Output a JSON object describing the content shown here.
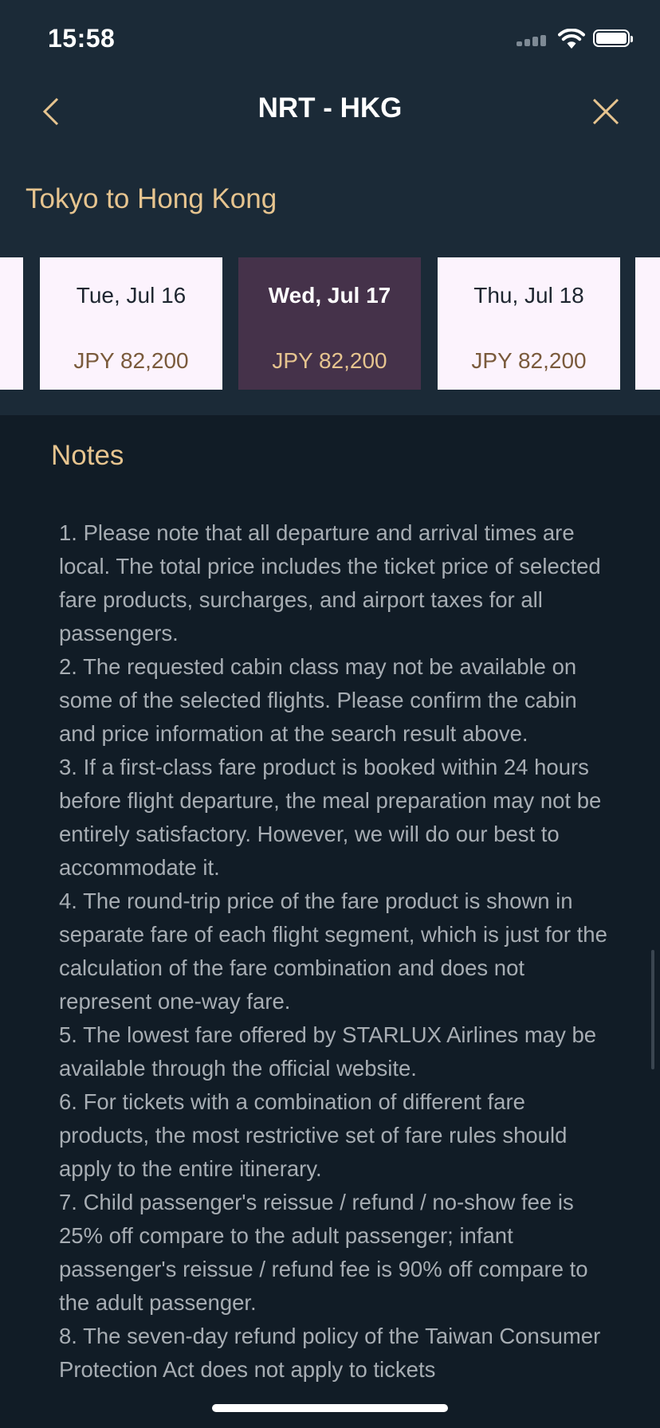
{
  "status_bar": {
    "time": "15:58"
  },
  "nav": {
    "title": "NRT - HKG",
    "back_icon": "chevron-left-icon",
    "close_icon": "close-icon",
    "accent_color": "#e6c48f"
  },
  "route": {
    "subtitle": "Tokyo to Hong Kong"
  },
  "dates": [
    {
      "date": "",
      "price": ""
    },
    {
      "date": "Tue, Jul 16",
      "price": "JPY 82,200"
    },
    {
      "date": "Wed, Jul 17",
      "price": "JPY 82,200",
      "selected": true
    },
    {
      "date": "Thu, Jul 18",
      "price": "JPY 82,200"
    },
    {
      "date": "",
      "price": ""
    }
  ],
  "notes": {
    "title": "Notes",
    "items": [
      "1. Please note that all departure and arrival times are local. The total price includes the ticket price of selected fare products, surcharges, and airport taxes for all passengers.",
      "2. The requested cabin class may not be available on some of the selected flights. Please confirm the cabin and price information at the search result above.",
      "3. If a first-class fare product is booked within 24 hours before flight departure, the meal preparation may not be entirely satisfactory. However, we will do our best to accommodate it.",
      "4. The round-trip price of the fare product is shown in separate fare of each flight segment, which is just for the calculation of the fare combination and does not represent one-way fare.",
      "5. The lowest fare offered by STARLUX Airlines may be available through the official website.",
      "6. For tickets with a combination of different fare products, the most restrictive set of fare rules should apply to the entire itinerary.",
      "7. Child passenger's reissue / refund / no-show fee is 25% off compare to the adult passenger; infant passenger's reissue / refund fee is 90% off compare to the adult passenger.",
      "8. The seven-day refund policy of the Taiwan Consumer Protection Act does not apply to tickets"
    ]
  }
}
